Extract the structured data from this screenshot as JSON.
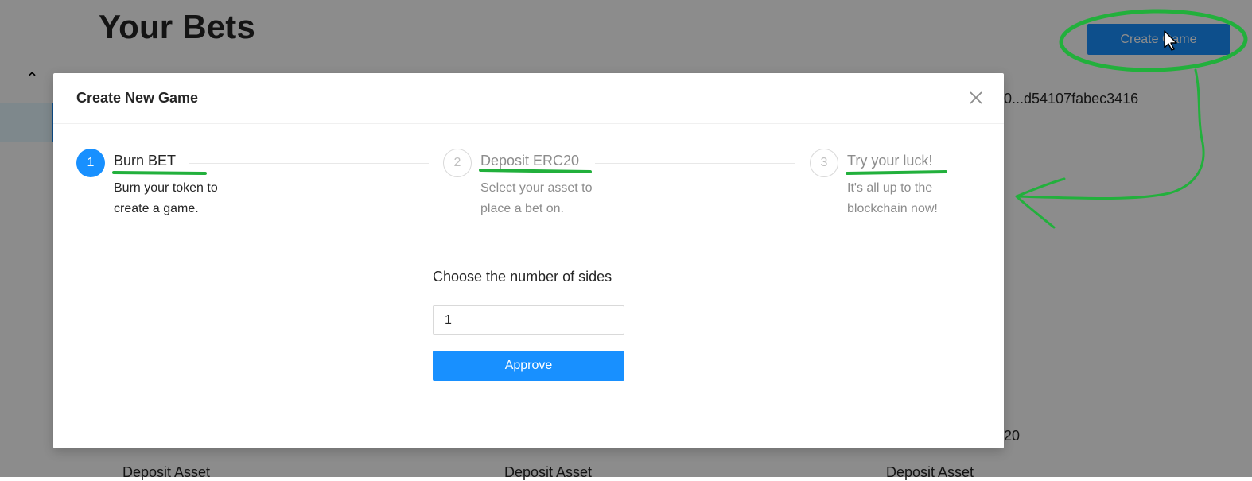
{
  "page": {
    "title": "Your Bets",
    "create_game_label": "Create Game",
    "address": "0...d54107fabec3416",
    "partial_20": "20",
    "deposit_asset_labels": [
      "Deposit Asset",
      "Deposit Asset",
      "Deposit Asset"
    ],
    "collapse_caret": "⌃"
  },
  "modal": {
    "title": "Create New Game",
    "steps": [
      {
        "number": "1",
        "title": "Burn BET",
        "desc": "Burn your token to create a game.",
        "status": "active"
      },
      {
        "number": "2",
        "title": "Deposit ERC20",
        "desc": "Select your asset to place a bet on.",
        "status": "waiting"
      },
      {
        "number": "3",
        "title": "Try your luck!",
        "desc": "It's all up to the blockchain now!",
        "status": "waiting"
      }
    ],
    "sides_label": "Choose the number of sides",
    "sides_value": "1",
    "approve_label": "Approve"
  },
  "colors": {
    "primary": "#1890ff",
    "annotation": "#22b03c",
    "mask": "rgba(0,0,0,0.45)"
  },
  "icons": {
    "close": "close-icon",
    "cursor": "mouse-cursor-icon"
  }
}
